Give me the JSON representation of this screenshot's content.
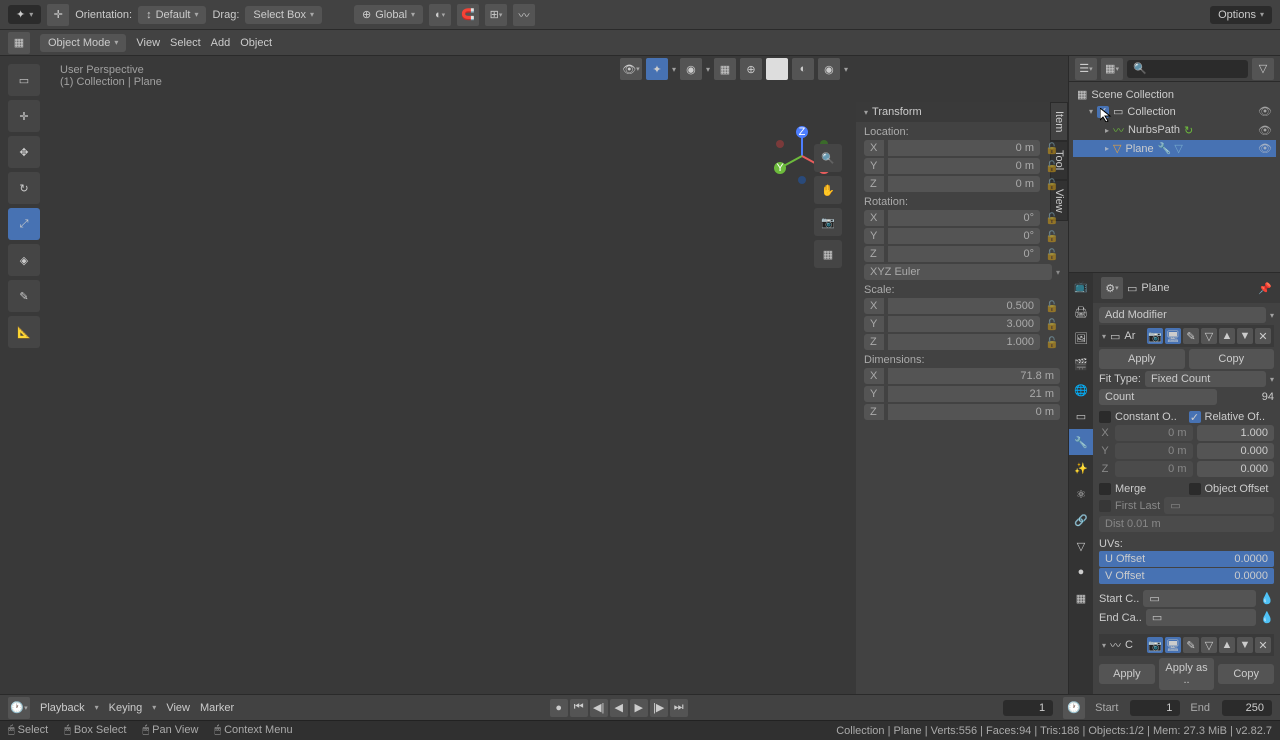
{
  "topbar": {
    "orientation_label": "Orientation:",
    "orientation_value": "Default",
    "drag_label": "Drag:",
    "drag_value": "Select Box",
    "global": "Global",
    "options": "Options"
  },
  "topbar2": {
    "mode": "Object Mode",
    "view": "View",
    "select": "Select",
    "add": "Add",
    "object": "Object"
  },
  "viewport": {
    "perspective": "User Perspective",
    "context": "(1) Collection | Plane"
  },
  "npanel": {
    "title": "Transform",
    "location": "Location:",
    "rotation": "Rotation:",
    "rot_mode": "XYZ Euler",
    "scale": "Scale:",
    "dimensions": "Dimensions:",
    "loc_x": "0 m",
    "loc_y": "0 m",
    "loc_z": "0 m",
    "rot_x": "0°",
    "rot_y": "0°",
    "rot_z": "0°",
    "scl_x": "0.500",
    "scl_y": "3.000",
    "scl_z": "1.000",
    "dim_x": "71.8 m",
    "dim_y": "21 m",
    "dim_z": "0 m",
    "tab_item": "Item",
    "tab_tool": "Tool",
    "tab_view": "View"
  },
  "outliner": {
    "root": "Scene Collection",
    "collection": "Collection",
    "nurbs": "NurbsPath",
    "plane": "Plane"
  },
  "props": {
    "object_name": "Plane",
    "add_modifier": "Add Modifier",
    "mod_name": "Ar",
    "apply": "Apply",
    "copy": "Copy",
    "fit_type_label": "Fit Type:",
    "fit_type": "Fixed Count",
    "count_label": "Count",
    "count": "94",
    "constant_offset": "Constant O..",
    "relative_offset": "Relative Of..",
    "off_x": "0 m",
    "off_rx": "1.000",
    "off_y": "0 m",
    "off_ry": "0.000",
    "off_z": "0 m",
    "off_rz": "0.000",
    "merge": "Merge",
    "object_offset": "Object Offset",
    "first_last": "First Last",
    "dist": "Dist 0.01 m",
    "uvs": "UVs:",
    "u_offset": "U Offset",
    "u_val": "0.0000",
    "v_offset": "V Offset",
    "v_val": "0.0000",
    "start_cap": "Start C..",
    "end_cap": "End Ca..",
    "curve_name": "C",
    "apply2": "Apply",
    "apply_as": "Apply as ..",
    "copy2": "Copy"
  },
  "timeline": {
    "playback": "Playback",
    "keying": "Keying",
    "view": "View",
    "marker": "Marker",
    "current": "1",
    "start_label": "Start",
    "start": "1",
    "end_label": "End",
    "end": "250"
  },
  "status": {
    "select": "Select",
    "box": "Box Select",
    "pan": "Pan View",
    "context": "Context Menu",
    "info": "Collection | Plane | Verts:556 | Faces:94 | Tris:188 | Objects:1/2 | Mem: 27.3 MiB | v2.82.7"
  }
}
